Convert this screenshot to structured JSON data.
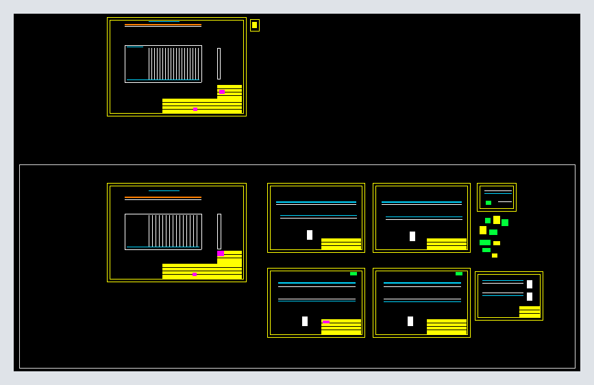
{
  "app": {
    "title": "",
    "view": "model-space"
  },
  "colors": {
    "background": "#000000",
    "window_border": "#dfe3e8",
    "sheet_border": "#ffff00",
    "cyan_lines": "#00d6ff",
    "green_tags": "#00ff3a",
    "magenta_blocks": "#ff00ff",
    "frame_outline": "#d8d8d8"
  },
  "icons": {
    "viewport_ucs": "ucs-icon"
  },
  "sheets": [
    {
      "id": "sheet-top",
      "name": "drawing-sheet-top"
    },
    {
      "id": "sheet-main-1",
      "name": "drawing-sheet-main-1"
    },
    {
      "id": "sheet-main-2",
      "name": "drawing-sheet-main-2"
    },
    {
      "id": "sheet-main-3",
      "name": "drawing-sheet-main-3"
    },
    {
      "id": "sheet-main-4",
      "name": "drawing-sheet-main-4"
    },
    {
      "id": "sheet-main-5",
      "name": "drawing-sheet-main-5"
    },
    {
      "id": "sheet-small-1",
      "name": "drawing-sheet-small-1"
    },
    {
      "id": "sheet-small-2",
      "name": "drawing-sheet-small-2"
    }
  ]
}
